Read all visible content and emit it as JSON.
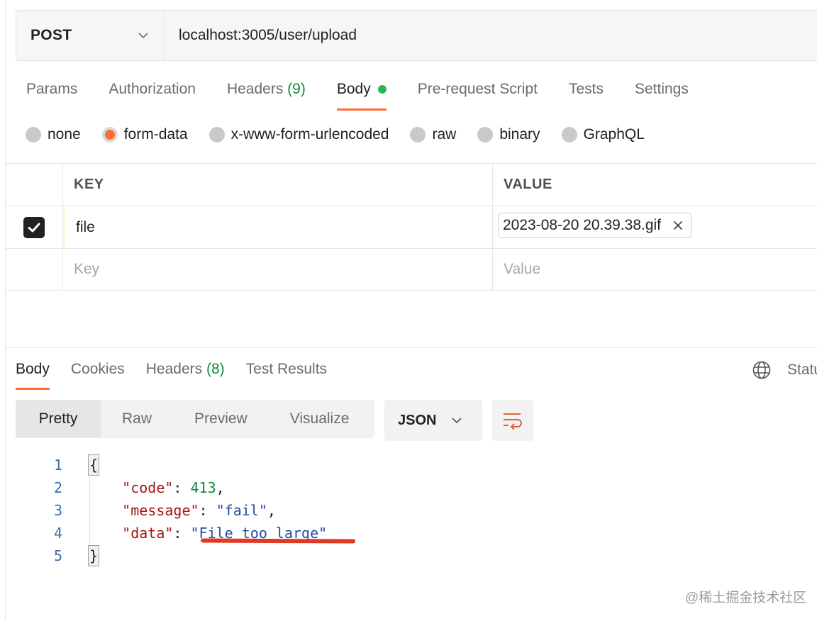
{
  "request": {
    "method": "POST",
    "url": "localhost:3005/user/upload"
  },
  "request_tabs": {
    "params": "Params",
    "authorization": "Authorization",
    "headers": "Headers",
    "headers_count": "(9)",
    "body": "Body",
    "prerequest": "Pre-request Script",
    "tests": "Tests",
    "settings": "Settings"
  },
  "body_types": {
    "none": "none",
    "form_data": "form-data",
    "urlencoded": "x-www-form-urlencoded",
    "raw": "raw",
    "binary": "binary",
    "graphql": "GraphQL",
    "selected": "form-data"
  },
  "kv_table": {
    "key_header": "KEY",
    "value_header": "VALUE",
    "rows": [
      {
        "key": "file",
        "value": "2023-08-20 20.39.38.gif",
        "checked": true
      }
    ],
    "key_placeholder": "Key",
    "value_placeholder": "Value"
  },
  "response_tabs": {
    "body": "Body",
    "cookies": "Cookies",
    "headers": "Headers",
    "headers_count": "(8)",
    "test_results": "Test Results",
    "status": "Statu"
  },
  "view_modes": {
    "pretty": "Pretty",
    "raw": "Raw",
    "preview": "Preview",
    "visualize": "Visualize",
    "format": "JSON"
  },
  "response_code": {
    "line_numbers": [
      "1",
      "2",
      "3",
      "4",
      "5"
    ],
    "open_brace": "{",
    "close_brace": "}",
    "code_key": "\"code\"",
    "code_value": "413",
    "message_key": "\"message\"",
    "message_value": "\"fail\"",
    "data_key": "\"data\"",
    "data_value": "\"File too large\""
  },
  "watermark": "@稀土掘金技术社区",
  "colors": {
    "accent": "#ff6c37",
    "green": "#2fb45b",
    "annotation_underline": "#e03a24"
  }
}
